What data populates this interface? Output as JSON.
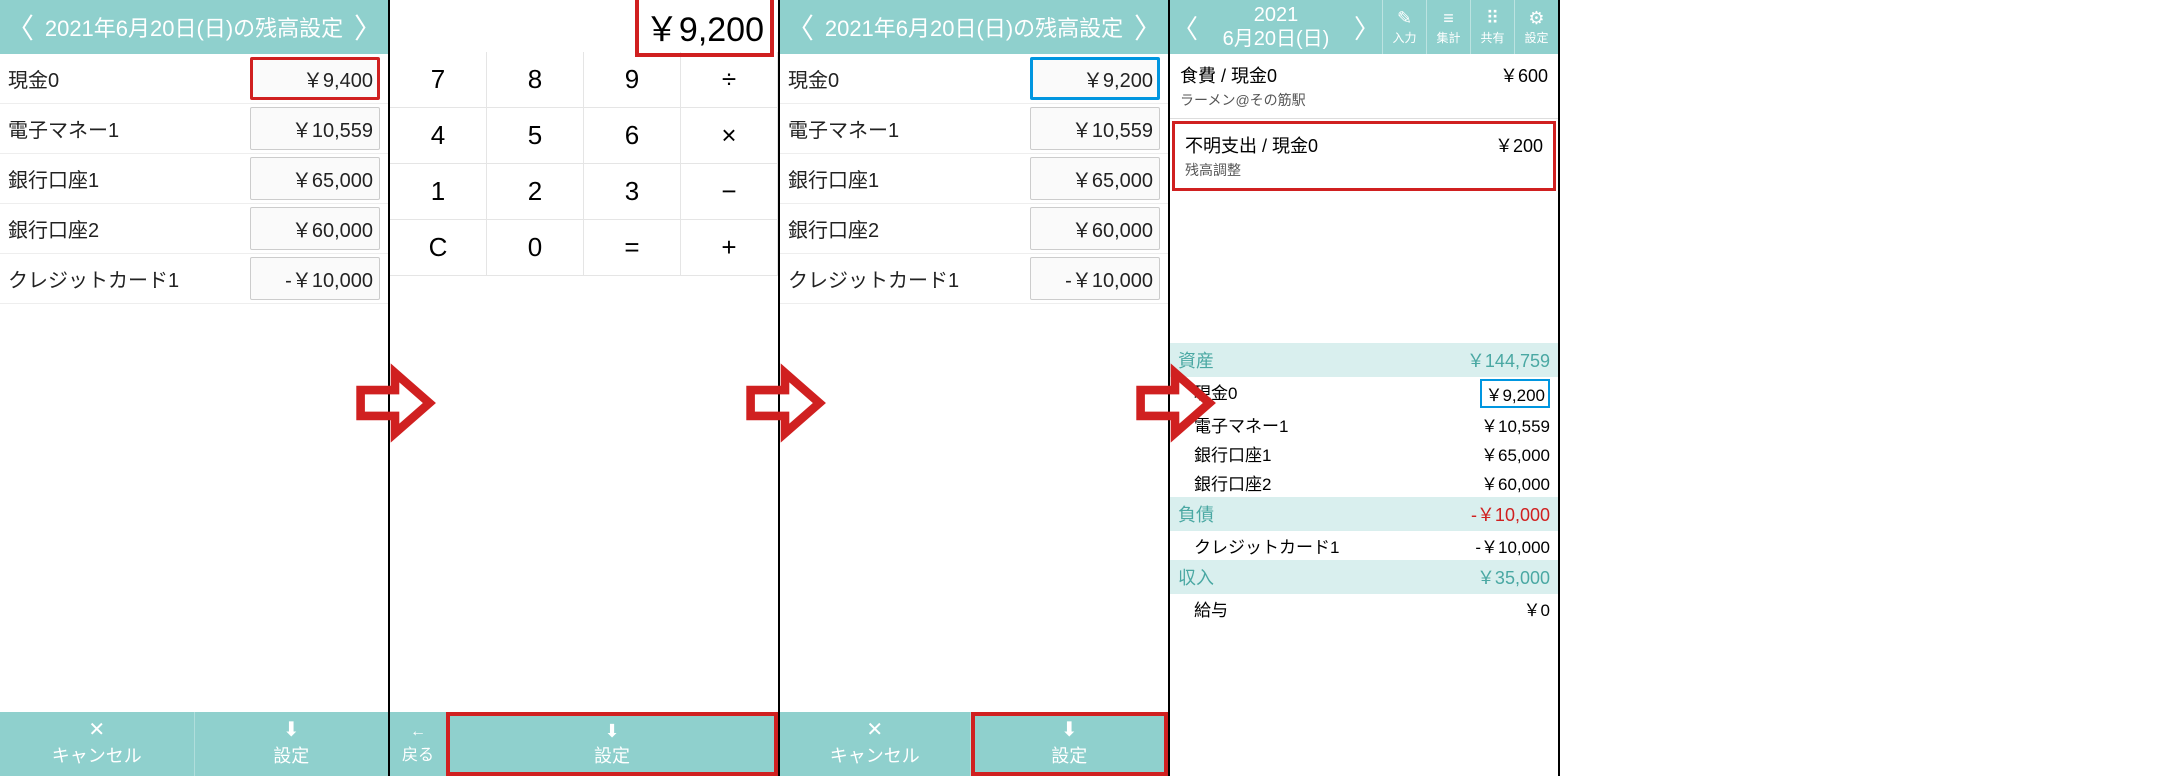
{
  "colors": {
    "teal": "#8fd0cd",
    "red": "#d02020",
    "blue": "#0096e0"
  },
  "panel1": {
    "title": "2021年6月20日(日)の残高設定",
    "rows": [
      {
        "label": "現金0",
        "value": "￥9,400",
        "hl": "red"
      },
      {
        "label": "電子マネー1",
        "value": "￥10,559"
      },
      {
        "label": "銀行口座1",
        "value": "￥65,000"
      },
      {
        "label": "銀行口座2",
        "value": "￥60,000"
      },
      {
        "label": "クレジットカード1",
        "value": "-￥10,000"
      }
    ],
    "cancel": "キャンセル",
    "set": "設定"
  },
  "panel2": {
    "display": "￥9,200",
    "keys": [
      "7",
      "8",
      "9",
      "÷",
      "4",
      "5",
      "6",
      "×",
      "1",
      "2",
      "3",
      "−",
      "C",
      "0",
      "=",
      "+"
    ],
    "back": "戻る",
    "set": "設定"
  },
  "panel3": {
    "title": "2021年6月20日(日)の残高設定",
    "rows": [
      {
        "label": "現金0",
        "value": "￥9,200",
        "hl": "blue"
      },
      {
        "label": "電子マネー1",
        "value": "￥10,559"
      },
      {
        "label": "銀行口座1",
        "value": "￥65,000"
      },
      {
        "label": "銀行口座2",
        "value": "￥60,000"
      },
      {
        "label": "クレジットカード1",
        "value": "-￥10,000"
      }
    ],
    "cancel": "キャンセル",
    "set": "設定"
  },
  "panel4": {
    "date_line1": "2021",
    "date_line2": "6月20日(日)",
    "tools": [
      {
        "name": "input",
        "label": "入力",
        "icon": "✎"
      },
      {
        "name": "summary",
        "label": "集計",
        "icon": "≡"
      },
      {
        "name": "share",
        "label": "共有",
        "icon": "⠿"
      },
      {
        "name": "settings",
        "label": "設定",
        "icon": "⚙"
      }
    ],
    "transactions": [
      {
        "cat": "食費 / 現金0",
        "sub": "ラーメン@その筋駅",
        "amt": "￥600"
      },
      {
        "cat": "不明支出 / 現金0",
        "sub": "残高調整",
        "amt": "￥200",
        "hl": true
      }
    ],
    "sections": [
      {
        "head": "資産",
        "total": "￥144,759",
        "rows": [
          {
            "l": "現金0",
            "v": "￥9,200",
            "boxed": true
          },
          {
            "l": "電子マネー1",
            "v": "￥10,559"
          },
          {
            "l": "銀行口座1",
            "v": "￥65,000"
          },
          {
            "l": "銀行口座2",
            "v": "￥60,000"
          }
        ]
      },
      {
        "head": "負債",
        "total": "-￥10,000",
        "neg": true,
        "rows": [
          {
            "l": "クレジットカード1",
            "v": "-￥10,000"
          }
        ]
      },
      {
        "head": "収入",
        "total": "￥35,000",
        "rows": [
          {
            "l": "給与",
            "v": "￥0"
          }
        ]
      }
    ]
  }
}
